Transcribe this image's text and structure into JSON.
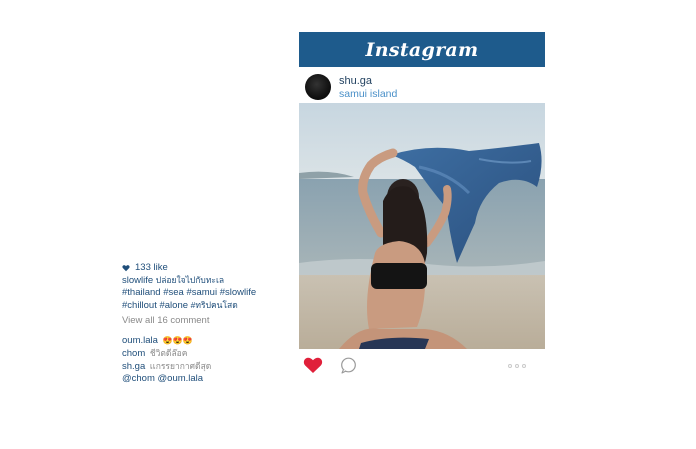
{
  "header": {
    "logo_text": "Instagram",
    "brand_color": "#1e5b8c"
  },
  "post": {
    "username": "shu.ga",
    "location": "samui island",
    "photo_description_icon": "photo"
  },
  "actions": {
    "like_icon": "heart-filled-icon",
    "like_color": "#e0203a",
    "comment_icon": "comment-bubble-icon",
    "more_icon": "more-dots-icon"
  },
  "caption": {
    "likes": "133 like",
    "author": "slowlife",
    "author_text": "ปล่อยใจไปกับทะเล",
    "hashtags_1": "#thailand #sea #samui #slowlife",
    "hashtags_2": "#chillout #alone",
    "hashtags_2_thai": "#ทริปคนโสด",
    "view_all": "View all 16 comment"
  },
  "comments": [
    {
      "user": "oum.lala",
      "text": "",
      "emoji": "😍😍😍"
    },
    {
      "user": "chom",
      "text": "ชีวิตดีล๊อค",
      "emoji": ""
    },
    {
      "user": "sh.ga",
      "text": "เเกรรยากาศดีสุด",
      "emoji": ""
    },
    {
      "user": "@chom @oum.lala",
      "text": "",
      "emoji": ""
    }
  ]
}
